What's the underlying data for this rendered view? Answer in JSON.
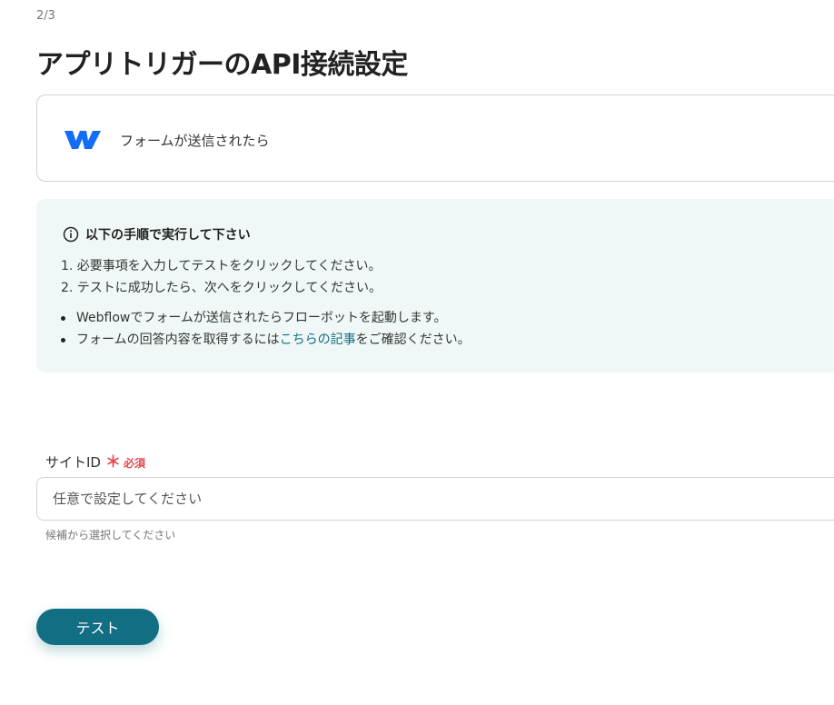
{
  "step": "2/3",
  "title": "アプリトリガーのAPI接続設定",
  "trigger": {
    "app_icon": "webflow-logo",
    "label": "フォームが送信されたら"
  },
  "info": {
    "icon": "info-circle-icon",
    "heading": "以下の手順で実行して下さい",
    "steps": [
      "1. 必要事項を入力してテストをクリックしてください。",
      "2. テストに成功したら、次へをクリックしてください。"
    ],
    "bullets": {
      "first": "Webflowでフォームが送信されたらフローボットを起動します。",
      "second_before": "フォームの回答内容を取得するには",
      "second_link": "こちらの記事",
      "second_after": "をご確認ください。"
    }
  },
  "site_field": {
    "label": "サイトID",
    "required_mark": "＊",
    "required_text": "必須",
    "placeholder": "任意で設定してください",
    "help": "候補から選択してください"
  },
  "test_button": {
    "label": "テスト"
  },
  "colors": {
    "accent": "#126e82",
    "info_bg": "#f0f8f7",
    "required": "#e5484d",
    "webflow_blue": "#146ef5"
  }
}
